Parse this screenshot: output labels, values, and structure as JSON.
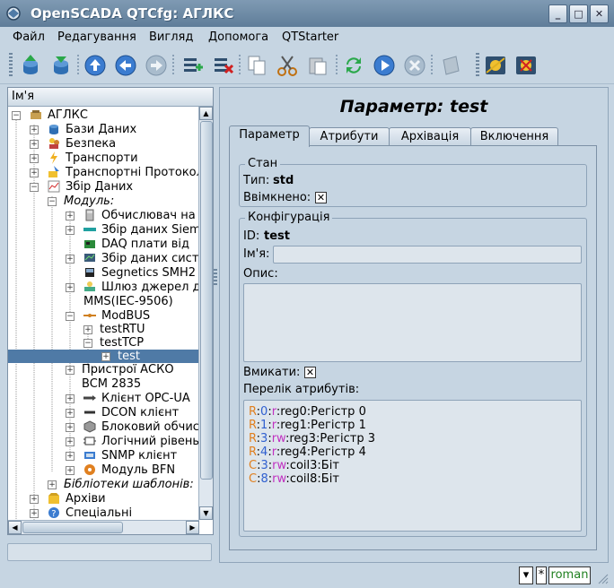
{
  "window": {
    "title": "OpenSCADA QTCfg: АГЛКС"
  },
  "menu": [
    "Файл",
    "Редагування",
    "Вигляд",
    "Допомога",
    "QTStarter"
  ],
  "toolbar_icons": [
    "db-load-icon",
    "db-save-icon",
    "up-icon",
    "back-icon",
    "forward-icon",
    "add-item-icon",
    "delete-item-icon",
    "copy-icon",
    "cut-icon",
    "paste-icon",
    "refresh-icon",
    "start-icon",
    "stop-icon",
    "info-icon",
    "connect-station-icon",
    "disconnect-station-icon"
  ],
  "tree": {
    "header": "Ім'я",
    "items": [
      {
        "label": "АГЛКС",
        "icon": "station-icon"
      },
      {
        "label": "Бази Даних",
        "icon": "database-icon"
      },
      {
        "label": "Безпека",
        "icon": "users-icon"
      },
      {
        "label": "Транспорти",
        "icon": "lightning-icon"
      },
      {
        "label": "Транспортні Протоколи",
        "icon": "protocol-icon"
      },
      {
        "label": "Збір Даних",
        "icon": "chart-icon"
      },
      {
        "label": "Модуль:",
        "icon": ""
      },
      {
        "label": "Обчислювач на",
        "icon": "calculator-icon"
      },
      {
        "label": "Збір даних Siemens",
        "icon": "siemens-icon"
      },
      {
        "label": "DAQ плати від",
        "icon": "board-icon"
      },
      {
        "label": "Збір даних систем",
        "icon": "system-icon"
      },
      {
        "label": "Segnetics SMH2",
        "icon": "segnetics-icon"
      },
      {
        "label": "Шлюз джерел д",
        "icon": "gateway-icon"
      },
      {
        "label": "MMS(IEC-9506)",
        "icon": ""
      },
      {
        "label": "ModBUS",
        "icon": "modbus-icon"
      },
      {
        "label": "testRTU",
        "icon": ""
      },
      {
        "label": "testTCP",
        "icon": ""
      },
      {
        "label": "test",
        "icon": ""
      },
      {
        "label": "Пристрої АСКО",
        "icon": ""
      },
      {
        "label": "BCM 2835",
        "icon": ""
      },
      {
        "label": "Клієнт OPC-UA",
        "icon": "opcua-icon"
      },
      {
        "label": "DCON клієнт",
        "icon": "dcon-icon"
      },
      {
        "label": "Блоковий обчис",
        "icon": "block-icon"
      },
      {
        "label": "Логічний рівень",
        "icon": "logic-icon"
      },
      {
        "label": "SNMP клієнт",
        "icon": "snmp-icon"
      },
      {
        "label": "Модуль BFN",
        "icon": "bfn-icon"
      },
      {
        "label": "Бібліотеки шаблонів:",
        "icon": ""
      },
      {
        "label": "Архіви",
        "icon": "archive-icon"
      },
      {
        "label": "Спеціальні",
        "icon": "help-icon"
      }
    ]
  },
  "panel": {
    "title": "Параметр: test",
    "tabs": [
      "Параметр",
      "Атрибути",
      "Архівація",
      "Включення"
    ],
    "state": {
      "legend": "Стан",
      "type_label": "Тип:",
      "type_value": "std",
      "enabled_label": "Ввімкнено:"
    },
    "config": {
      "legend": "Конфігурація",
      "id_label": "ID:",
      "id_value": "test",
      "name_label": "Ім'я:",
      "name_value": "",
      "descr_label": "Опис:",
      "descr_value": "",
      "enable_label": "Вмикати:",
      "attr_list_label": "Перелік атрибутів:",
      "attrs": [
        {
          "t": "R",
          "addr": "0",
          "mode": "r",
          "rest": "reg0:Регістр 0"
        },
        {
          "t": "R",
          "addr": "1",
          "mode": "r",
          "rest": "reg1:Регістр 1"
        },
        {
          "t": "R",
          "addr": "3",
          "mode": "rw",
          "rest": "reg3:Регістр 3"
        },
        {
          "t": "R",
          "addr": "4",
          "mode": "r",
          "rest": "reg4:Регістр 4"
        },
        {
          "t": "C",
          "addr": "3",
          "mode": "rw",
          "rest": "coil3:Біт"
        },
        {
          "t": "C",
          "addr": "8",
          "mode": "rw",
          "rest": "coil8:Біт"
        }
      ]
    }
  },
  "statusbar": {
    "asterisk": "*",
    "user": "roman"
  },
  "colors": {
    "type": "#e08020",
    "addr": "#3060d0",
    "mode": "#c030c0",
    "user": "#208020"
  }
}
